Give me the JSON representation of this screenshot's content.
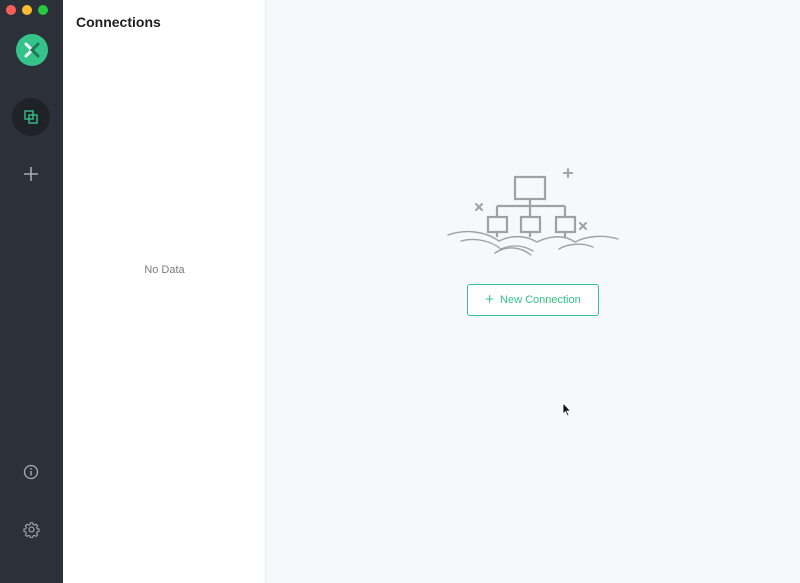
{
  "window": {
    "controls": [
      "close",
      "minimize",
      "zoom"
    ]
  },
  "rail": {
    "logo_icon": "mqttx-logo-icon",
    "items": [
      {
        "name": "connections",
        "icon": "connections-icon",
        "active": true
      },
      {
        "name": "new-connection",
        "icon": "plus-icon",
        "active": false
      }
    ],
    "bottom_items": [
      {
        "name": "about",
        "icon": "info-icon"
      },
      {
        "name": "settings",
        "icon": "gear-icon"
      }
    ]
  },
  "list_panel": {
    "title": "Connections",
    "empty_text": "No Data"
  },
  "main": {
    "illustration_icon": "network-topology-illustration",
    "new_connection_label": "New Connection"
  },
  "colors": {
    "accent": "#34c388",
    "rail_bg": "#2c3039",
    "panel_bg": "#ffffff",
    "main_bg": "#f7f8fb"
  }
}
